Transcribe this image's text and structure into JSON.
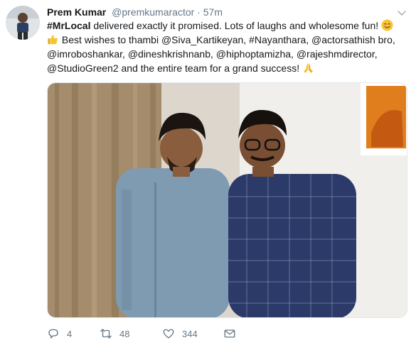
{
  "author": {
    "name": "Prem Kumar",
    "handle": "@premkumaractor",
    "separator": "·",
    "time": "57m"
  },
  "tweet": {
    "hashtag": "#MrLocal",
    "line1_rest": " delivered exactly it promised. Lots of laughs and wholesome fun!",
    "line2": " Best wishes to thambi @Siva_Kartikeyan, #Nayanthara, @actorsathish bro,",
    "line3": "@imroboshankar, @dineshkrishnanb, @hiphoptamizha, @rajeshmdirector,",
    "line4": "@StudioGreen2 and the entire team for a grand success!"
  },
  "icons": {
    "smile": "smiling-face-emoji",
    "thumbs": "thumbs-up-emoji",
    "pray": "folded-hands-emoji",
    "reply": "reply-icon",
    "retweet": "retweet-icon",
    "like": "heart-icon",
    "dm": "mail-icon",
    "caret": "chevron-down-icon"
  },
  "counts": {
    "replies": "4",
    "retweets": "48",
    "likes": "344"
  },
  "colors": {
    "text": "#14171a",
    "muted": "#657786",
    "emoji_yellow": "#f7c431"
  }
}
